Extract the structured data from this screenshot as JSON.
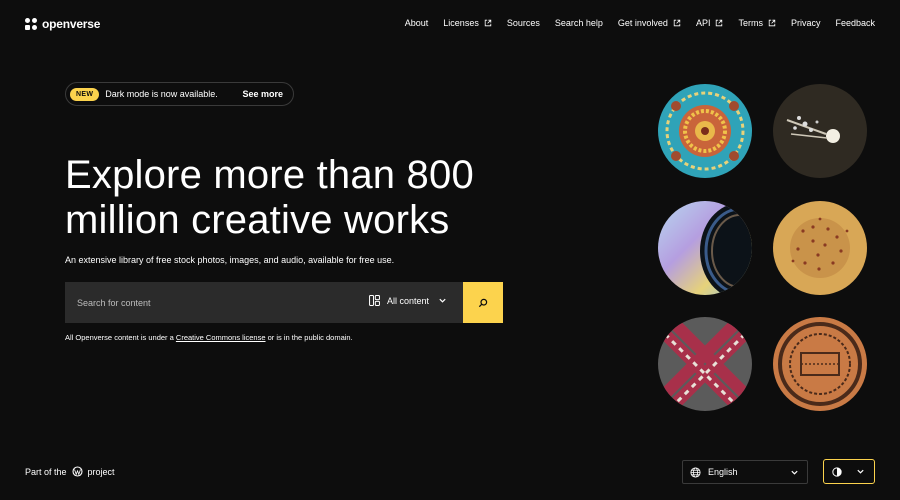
{
  "header": {
    "logo_text": "openverse",
    "nav": [
      {
        "label": "About",
        "external": false
      },
      {
        "label": "Licenses",
        "external": true
      },
      {
        "label": "Sources",
        "external": false
      },
      {
        "label": "Search help",
        "external": false
      },
      {
        "label": "Get involved",
        "external": true
      },
      {
        "label": "API",
        "external": true
      },
      {
        "label": "Terms",
        "external": true
      },
      {
        "label": "Privacy",
        "external": false
      },
      {
        "label": "Feedback",
        "external": false
      }
    ]
  },
  "banner": {
    "badge": "NEW",
    "text": "Dark mode is now available.",
    "link": "See more"
  },
  "hero": {
    "title_line1": "Explore more than 800",
    "title_line2": "million creative works",
    "subtitle": "An extensive library of free stock photos, images, and audio, available for free use."
  },
  "search": {
    "placeholder": "Search for content",
    "content_type": "All content"
  },
  "license_note": {
    "before": "All Openverse content is under a ",
    "link": "Creative Commons license",
    "after": " or is in the public domain."
  },
  "footer": {
    "part_of_before": "Part of the",
    "part_of_after": "project",
    "language": "English"
  },
  "colors": {
    "accent": "#fcd34d",
    "background": "#0d0d0d",
    "surface": "#2b2b2b"
  },
  "icons": {
    "external": "external-link-icon",
    "content_type": "content-type-icon",
    "search": "search-icon",
    "globe": "globe-icon",
    "theme": "contrast-icon",
    "chevron": "chevron-down-icon",
    "wordpress": "wordpress-icon"
  }
}
